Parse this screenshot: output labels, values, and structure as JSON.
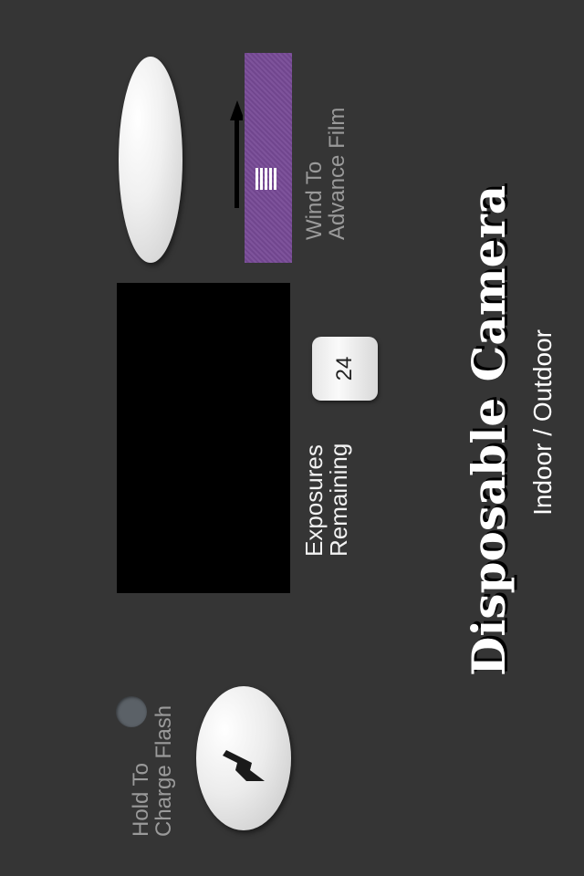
{
  "film": {
    "wind_label_line1": "Wind To",
    "wind_label_line2": "Advance Film",
    "accent_color": "#774a96"
  },
  "counter": {
    "value": "24",
    "label_line1": "Exposures",
    "label_line2": "Remaining"
  },
  "flash": {
    "label_line1": "Hold To",
    "label_line2": "Charge Flash",
    "indicator_color": "#5b6167"
  },
  "branding": {
    "title": "Disposable Camera",
    "subtitle": "Indoor / Outdoor"
  },
  "icons": {
    "wind": "up-arrow-icon",
    "flash": "lightning-bolt-icon"
  }
}
